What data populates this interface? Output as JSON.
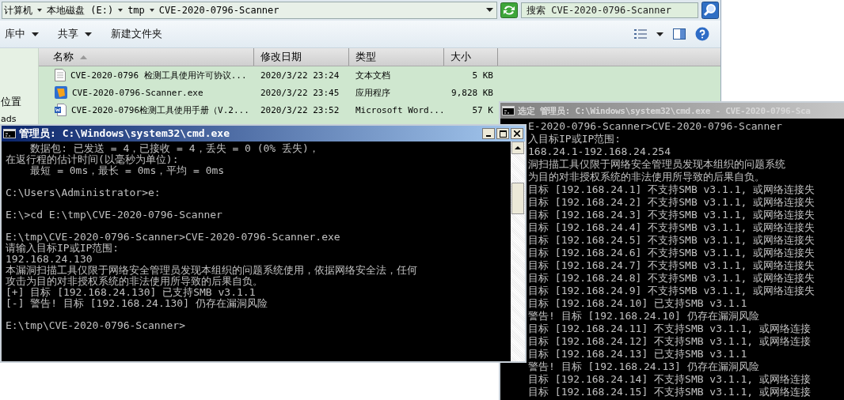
{
  "explorer": {
    "breadcrumb": [
      "计算机",
      "本地磁盘 (E:)",
      "tmp",
      "CVE-2020-0796-Scanner"
    ],
    "search": {
      "placeholder": "搜索 CVE-2020-0796-Scanner"
    },
    "toolbar": [
      {
        "label": "库中",
        "dropdown": true
      },
      {
        "label": "共享",
        "dropdown": true
      },
      {
        "label": "新建文件夹",
        "dropdown": false
      }
    ],
    "nav_items": [
      "位置",
      "ads"
    ],
    "columns": [
      {
        "label": "名称",
        "sorted": true
      },
      {
        "label": "修改日期",
        "sorted": false
      },
      {
        "label": "类型",
        "sorted": false
      },
      {
        "label": "大小",
        "sorted": false
      }
    ],
    "rows": [
      {
        "name": "CVE-2020-0796 检测工具使用许可协议...",
        "date": "2020/3/22 23:24",
        "type": "文本文档",
        "size": "5 KB",
        "kind": "text"
      },
      {
        "name": "CVE-2020-0796-Scanner.exe",
        "date": "2020/3/22 23:45",
        "type": "应用程序",
        "size": "9,828 KB",
        "kind": "exe"
      },
      {
        "name": "CVE-2020-0796检测工具使用手册（V.2...",
        "date": "2020/3/22 23:52",
        "type": "Microsoft Word...",
        "size": "57 K",
        "kind": "word"
      }
    ]
  },
  "console_right": {
    "title": "选定 管理员: C:\\Windows\\system32\\cmd.exe - CVE-2020-0796-Sca",
    "active": false,
    "blocks": [
      [
        "E-2020-0796-Scanner>CVE-2020-0796-Scanner",
        "入目标IP或IP范围:",
        "168.24.1-192.168.24.254",
        "洞扫描工具仅限于网络安全管理员发现本组织的问题系统",
        "为目的对非授权系统的非法使用所导致的后果自负。",
        "目标 [192.168.24.1] 不支持SMB v3.1.1, 或网络连接失",
        "目标 [192.168.24.2] 不支持SMB v3.1.1, 或网络连接失",
        "目标 [192.168.24.3] 不支持SMB v3.1.1, 或网络连接失",
        "目标 [192.168.24.4] 不支持SMB v3.1.1, 或网络连接失",
        "目标 [192.168.24.5] 不支持SMB v3.1.1, 或网络连接失",
        "目标 [192.168.24.6] 不支持SMB v3.1.1, 或网络连接失",
        "目标 [192.168.24.7] 不支持SMB v3.1.1, 或网络连接失",
        "目标 [192.168.24.8] 不支持SMB v3.1.1, 或网络连接失",
        "目标 [192.168.24.9] 不支持SMB v3.1.1, 或网络连接失",
        "目标 [192.168.24.10] 已支持SMB v3.1.1",
        "警告! 目标 [192.168.24.10] 仍存在漏洞风险",
        "目标 [192.168.24.11] 不支持SMB v3.1.1, 或网络连接",
        "目标 [192.168.24.12] 不支持SMB v3.1.1, 或网络连接",
        "目标 [192.168.24.13] 已支持SMB v3.1.1",
        "警告! 目标 [192.168.24.13] 仍存在漏洞风险",
        "目标 [192.168.24.14] 不支持SMB v3.1.1, 或网络连接",
        "目标 [192.168.24.15] 不支持SMB v3.1.1, 或网络连接"
      ]
    ]
  },
  "console_left": {
    "title": "管理员: C:\\Windows\\system32\\cmd.exe",
    "active": true,
    "blocks": [
      [
        "    数据包: 已发送 = 4，已接收 = 4，丢失 = 0 (0% 丢失)，",
        "在返行程的估计时间(以毫秒为单位):",
        "    最短 = 0ms，最长 = 0ms，平均 = 0ms"
      ],
      [
        "C:\\Users\\Administrator>e:"
      ],
      [
        "E:\\>cd E:\\tmp\\CVE-2020-0796-Scanner"
      ],
      [
        "E:\\tmp\\CVE-2020-0796-Scanner>CVE-2020-0796-Scanner.exe",
        "请输入目标IP或IP范围:",
        "192.168.24.130",
        "本漏洞扫描工具仅限于网络安全管理员发现本组织的问题系统使用，依据网络安全法，任何",
        "攻击为目的对非授权系统的非法使用所导致的后果自负。",
        "[+] 目标 [192.168.24.130] 已支持SMB v3.1.1",
        "[-] 警告! 目标 [192.168.24.130] 仍存在漏洞风险"
      ],
      [
        "E:\\tmp\\CVE-2020-0796-Scanner>"
      ]
    ]
  }
}
